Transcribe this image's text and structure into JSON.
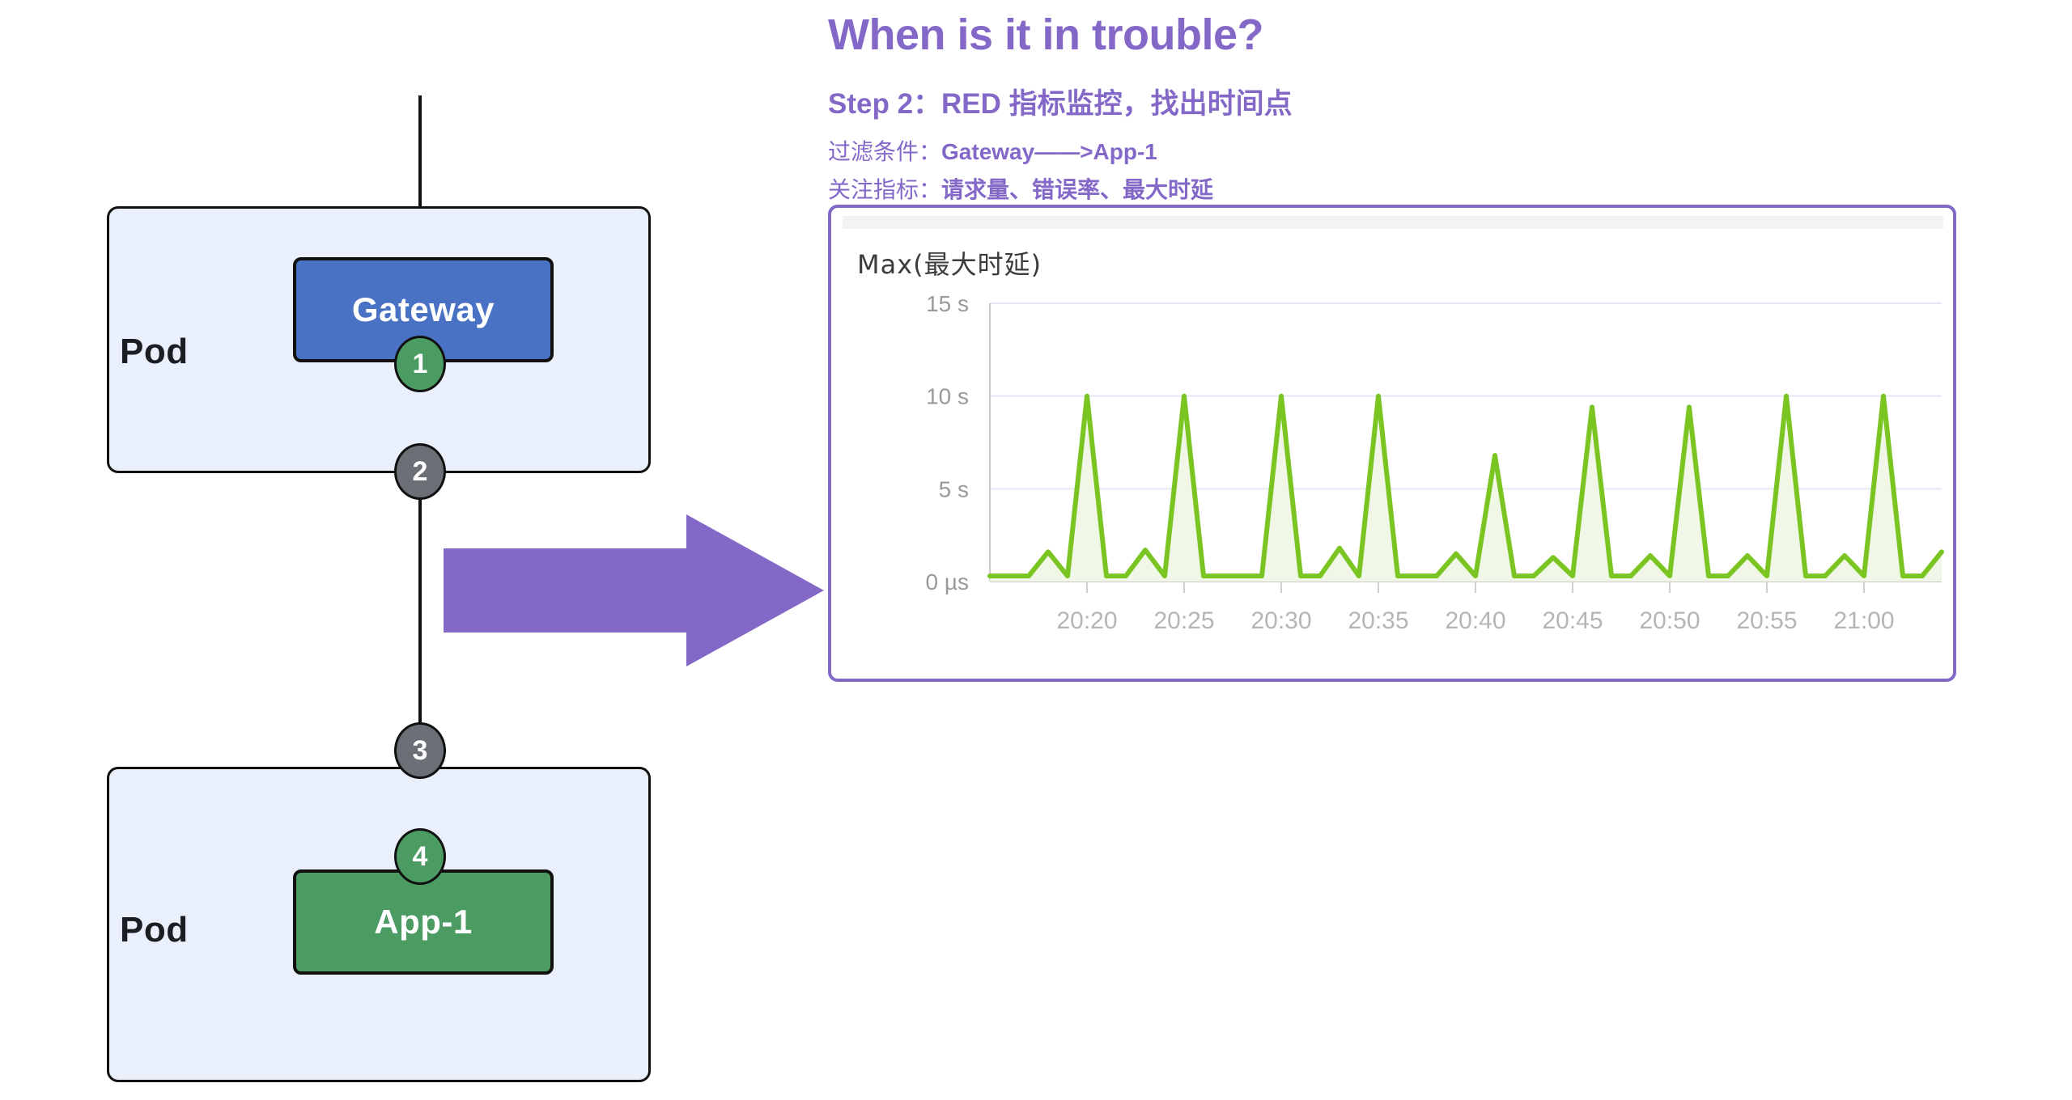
{
  "diagram": {
    "pods": [
      {
        "label": "Pod"
      },
      {
        "label": "Pod"
      }
    ],
    "services": [
      {
        "name": "Gateway",
        "color": "#4a72c4"
      },
      {
        "name": "App-1",
        "color": "#4b9b62"
      }
    ],
    "badges": [
      {
        "label": "1",
        "color": "#4b9b62",
        "kind": "green"
      },
      {
        "label": "2",
        "color": "#6b6f76",
        "kind": "grey"
      },
      {
        "label": "3",
        "color": "#6b6f76",
        "kind": "grey"
      },
      {
        "label": "4",
        "color": "#4b9b62",
        "kind": "green"
      }
    ],
    "arrow_icon": "right-arrow-icon",
    "arrow_color": "#8368c8"
  },
  "panel": {
    "headline": "When is it in trouble?",
    "step_title": "Step 2：RED 指标监控，找出时间点",
    "filter_label": "过滤条件：",
    "filter_value": "Gateway——>App-1",
    "metric_label": "关注指标：",
    "metric_value": "请求量、错误率、最大时延",
    "accent_color": "#8368c8"
  },
  "chart_data": {
    "type": "line",
    "title": "Max(最大时延)",
    "xlabel": "",
    "ylabel": "",
    "ylim": [
      0,
      15
    ],
    "grid": true,
    "legend": "none",
    "line_color": "#7ac522",
    "fill_color": "#f0f7e6",
    "ytick_labels": [
      "15 s",
      "10 s",
      "5 s",
      "0 µs"
    ],
    "ytick_values": [
      15,
      10,
      5,
      0
    ],
    "xtick_labels": [
      "20:20",
      "20:25",
      "20:30",
      "20:35",
      "20:40",
      "20:45",
      "20:50",
      "20:55",
      "21:00"
    ],
    "xtick_values": [
      5,
      10,
      15,
      20,
      25,
      30,
      35,
      40,
      45
    ],
    "x_range": [
      0,
      49
    ],
    "series": [
      {
        "name": "Max(最大时延)",
        "x": [
          0,
          1,
          2,
          3,
          4,
          5,
          6,
          7,
          8,
          9,
          10,
          11,
          12,
          13,
          14,
          15,
          16,
          17,
          18,
          19,
          20,
          21,
          22,
          23,
          24,
          25,
          26,
          27,
          28,
          29,
          30,
          31,
          32,
          33,
          34,
          35,
          36,
          37,
          38,
          39,
          40,
          41,
          42,
          43,
          44,
          45,
          46,
          47,
          48,
          49
        ],
        "values": [
          0.3,
          0.3,
          0.3,
          1.6,
          0.3,
          10.0,
          0.3,
          0.3,
          1.7,
          0.3,
          10.0,
          0.3,
          0.3,
          0.3,
          0.3,
          10.0,
          0.3,
          0.3,
          1.8,
          0.3,
          10.0,
          0.3,
          0.3,
          0.3,
          1.5,
          0.3,
          6.8,
          0.3,
          0.3,
          1.3,
          0.3,
          9.4,
          0.3,
          0.3,
          1.4,
          0.3,
          9.4,
          0.3,
          0.3,
          1.4,
          0.3,
          10.0,
          0.3,
          0.3,
          1.4,
          0.3,
          10.0,
          0.3,
          0.3,
          1.6
        ]
      }
    ]
  }
}
